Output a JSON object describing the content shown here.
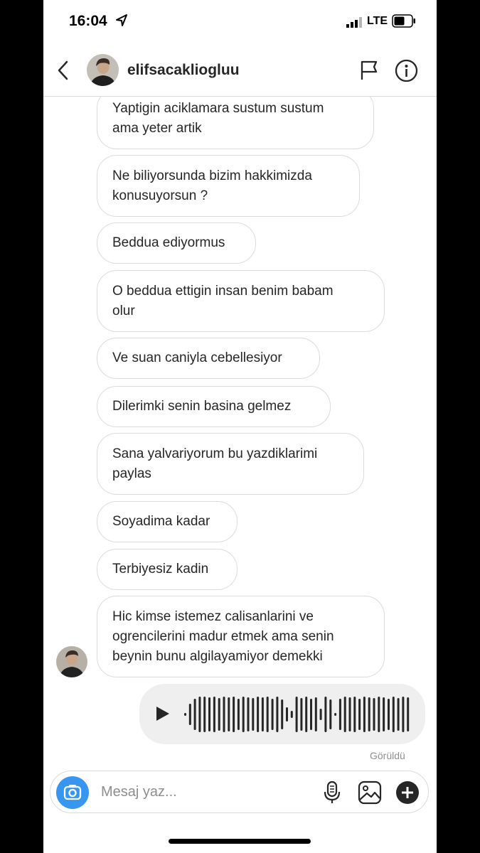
{
  "status": {
    "time": "16:04",
    "network": "LTE"
  },
  "header": {
    "username": "elifsacakliogluu"
  },
  "messages": [
    "Yaptigin aciklamara sustum sustum\nama yeter artik",
    "Ne biliyorsunda bizim hakkimizda\nkonusuyorsun ?",
    "Beddua ediyormus",
    "O beddua ettigin insan benim babam\nolur",
    "Ve suan caniyla cebellesiyor",
    "Dilerimki senin basina gelmez",
    "Sana yalvariyorum bu yazdiklarimi\npaylas",
    "Soyadima kadar",
    "Terbiyesiz kadin",
    "Hic kimse istemez calisanlarini ve\nogrencilerini madur etmek ama senin\nbeynin bunu algilayamiyor demekki"
  ],
  "seen_label": "Görüldü",
  "composer": {
    "placeholder": "Mesaj yaz..."
  },
  "colors": {
    "accent": "#3797f0",
    "bubble_border": "#dbdbdb",
    "voice_bg": "#efefef"
  }
}
